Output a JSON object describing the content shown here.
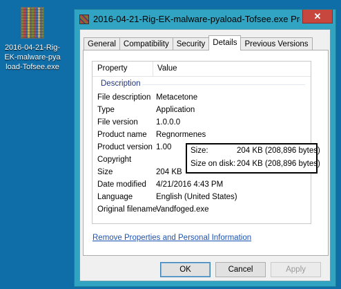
{
  "desktop": {
    "icon_label": "2016-04-21-Rig-EK-malware-pyaload-Tofsee.exe"
  },
  "window": {
    "title": "2016-04-21-Rig-EK-malware-pyaload-Tofsee.exe Pro...",
    "close_glyph": "✕"
  },
  "tabs": [
    {
      "label": "General"
    },
    {
      "label": "Compatibility"
    },
    {
      "label": "Security"
    },
    {
      "label": "Details"
    },
    {
      "label": "Previous Versions"
    }
  ],
  "details": {
    "col_property": "Property",
    "col_value": "Value",
    "group": "Description",
    "rows": [
      {
        "k": "File description",
        "v": "Metacetone"
      },
      {
        "k": "Type",
        "v": "Application"
      },
      {
        "k": "File version",
        "v": "1.0.0.0"
      },
      {
        "k": "Product name",
        "v": "Regnormenes"
      },
      {
        "k": "Product version",
        "v": "1.00"
      },
      {
        "k": "Copyright",
        "v": ""
      },
      {
        "k": "Size",
        "v": "204 KB"
      },
      {
        "k": "Date modified",
        "v": "4/21/2016 4:43 PM"
      },
      {
        "k": "Language",
        "v": "English (United States)"
      },
      {
        "k": "Original filename",
        "v": "Vandfoged.exe"
      }
    ]
  },
  "link": "Remove Properties and Personal Information",
  "buttons": {
    "ok": "OK",
    "cancel": "Cancel",
    "apply": "Apply"
  },
  "callout": {
    "size_label": "Size:",
    "size_value": "204 KB (208,896 bytes)",
    "disk_label": "Size on disk:",
    "disk_value": "204 KB (208,896 bytes)"
  }
}
